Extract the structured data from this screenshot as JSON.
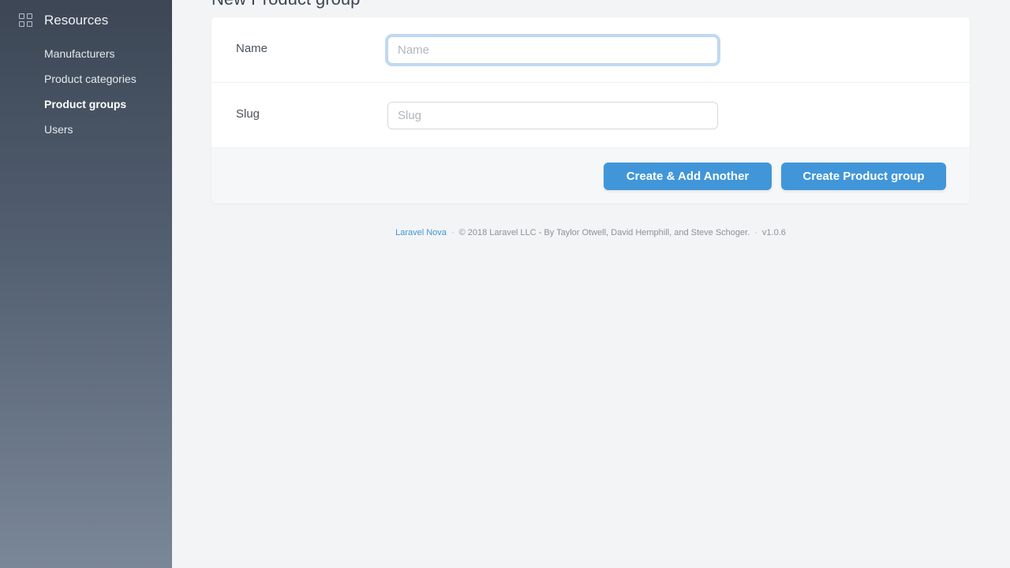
{
  "sidebar": {
    "section_title": "Resources",
    "section_icon": "grid-icon",
    "items": [
      {
        "label": "Manufacturers",
        "active": false
      },
      {
        "label": "Product categories",
        "active": false
      },
      {
        "label": "Product groups",
        "active": true
      },
      {
        "label": "Users",
        "active": false
      }
    ]
  },
  "page": {
    "title": "New Product group"
  },
  "form": {
    "fields": [
      {
        "label": "Name",
        "placeholder": "Name",
        "value": "",
        "focused": true
      },
      {
        "label": "Slug",
        "placeholder": "Slug",
        "value": "",
        "focused": false
      }
    ],
    "buttons": {
      "create_another": "Create & Add Another",
      "create": "Create Product group"
    }
  },
  "footer": {
    "link_text": "Laravel Nova",
    "separator": "·",
    "copyright": "© 2018 Laravel LLC - By Taylor Otwell, David Hemphill, and Steve Schoger.",
    "version": "v1.0.6"
  },
  "colors": {
    "primary": "#4196d9",
    "sidebar_top": "#3c4655",
    "sidebar_bottom": "#7a8799"
  }
}
